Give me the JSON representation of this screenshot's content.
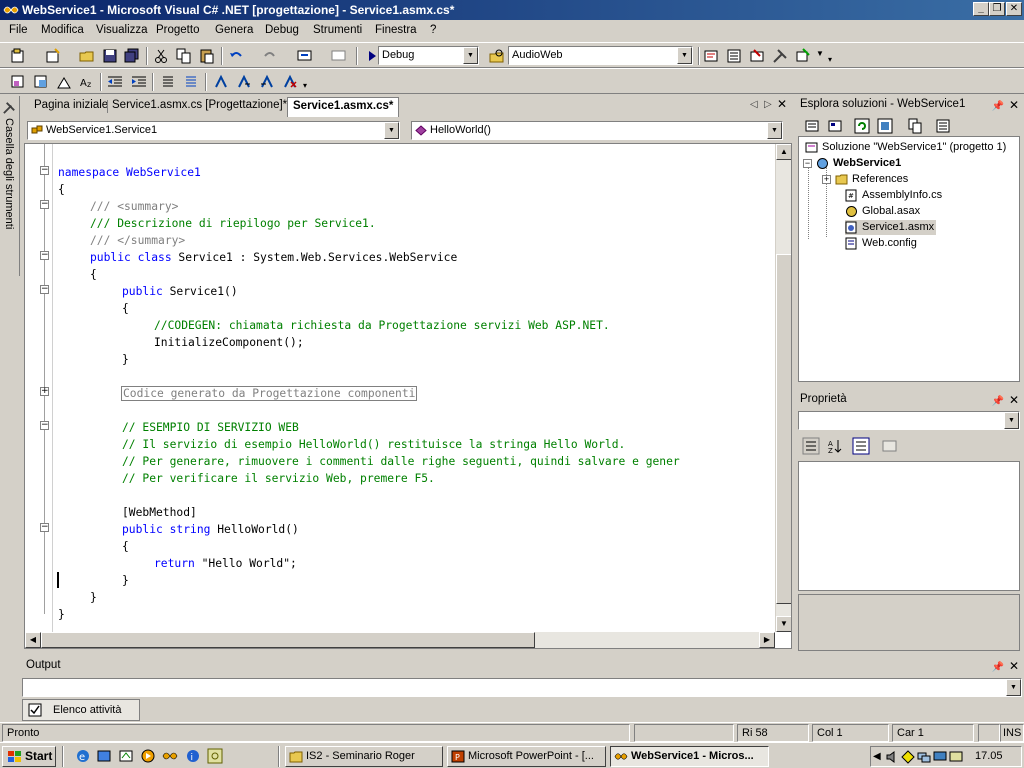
{
  "window": {
    "title": "WebService1 - Microsoft Visual C# .NET [progettazione] - Service1.asmx.cs*"
  },
  "menu": [
    "File",
    "Modifica",
    "Visualizza",
    "Progetto",
    "Genera",
    "Debug",
    "Strumenti",
    "Finestra",
    "?"
  ],
  "toolbar": {
    "config_value": "Debug",
    "search_value": "AudioWeb"
  },
  "toolbox": {
    "label": "Casella degli strumenti"
  },
  "tabs": [
    {
      "label": "Pagina iniziale"
    },
    {
      "label": "Service1.asmx.cs [Progettazione]*"
    },
    {
      "label": "Service1.asmx.cs*"
    }
  ],
  "nav": {
    "class_value": "WebService1.Service1",
    "member_value": "HelloWorld()"
  },
  "code": {
    "l1": "namespace WebService1",
    "l2": "{",
    "l3": "/// <summary>",
    "l4": "/// Descrizione di riepilogo per Service1.",
    "l5": "/// </summary>",
    "l6a": "public class",
    "l6b": " Service1 : System.Web.Services.WebService",
    "l7": "{",
    "l8a": "public",
    "l8b": " Service1()",
    "l9": "{",
    "l10": "//CODEGEN: chiamata richiesta da Progettazione servizi Web ASP.NET.",
    "l11": "InitializeComponent();",
    "l12": "}",
    "l13": "Codice generato da Progettazione componenti",
    "l14": "// ESEMPIO DI SERVIZIO WEB",
    "l15": "// Il servizio di esempio HelloWorld() restituisce la stringa Hello World.",
    "l16": "// Per generare, rimuovere i commenti dalle righe seguenti, quindi salvare e gener",
    "l17": "// Per verificare il servizio Web, premere F5.",
    "l18": "[WebMethod]",
    "l19a": "public string",
    "l19b": " HelloWorld()",
    "l20": "{",
    "l21a": "return",
    "l21b": " \"Hello World\";",
    "l22": "}",
    "l23": "}",
    "l24": "}"
  },
  "solution_explorer": {
    "title": "Esplora soluzioni - WebService1",
    "solution": "Soluzione \"WebService1\" (progetto 1)",
    "project": "WebService1",
    "items": [
      "References",
      "AssemblyInfo.cs",
      "Global.asax",
      "Service1.asmx",
      "Web.config"
    ]
  },
  "properties": {
    "title": "Proprietà"
  },
  "output": {
    "title": "Output"
  },
  "task_tab": {
    "label": "Elenco attività"
  },
  "status": {
    "message": "Pronto",
    "line": "Ri 58",
    "col": "Col 1",
    "char": "Car 1",
    "mode": "INS"
  },
  "taskbar": {
    "start": "Start",
    "tasks": [
      "IS2 - Seminario Roger",
      "Microsoft PowerPoint - [...",
      "WebService1 - Micros..."
    ],
    "clock": "17.05"
  }
}
